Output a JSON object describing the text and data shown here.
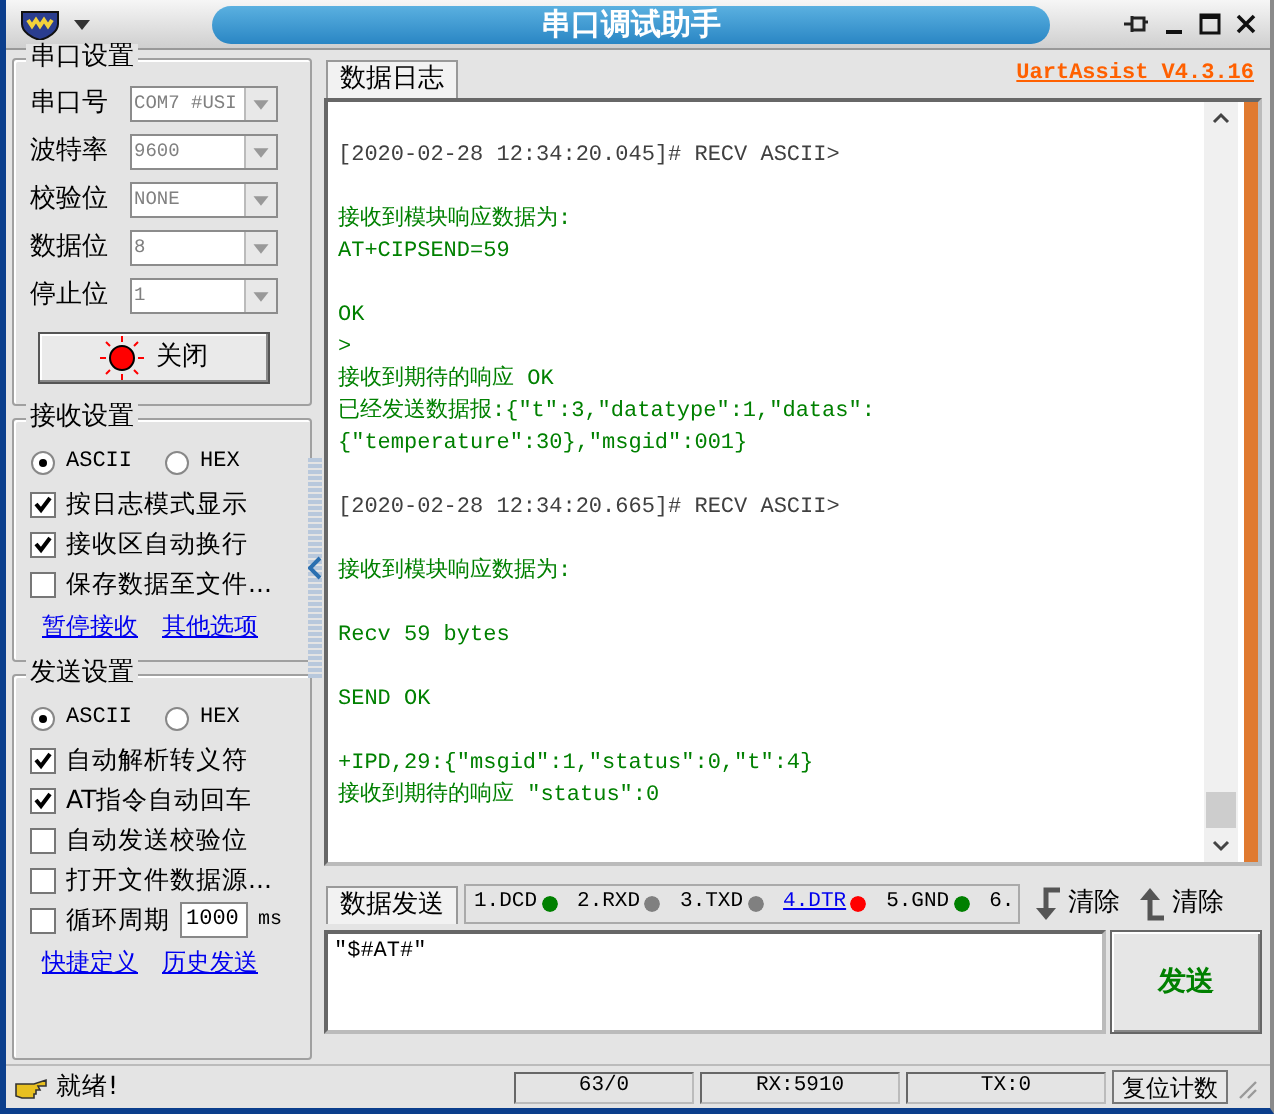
{
  "window": {
    "title": "串口调试助手"
  },
  "version_link": "UartAssist V4.3.16",
  "serial_settings": {
    "title": "串口设置",
    "fields": [
      {
        "label": "串口号",
        "value": "COM7 #USI"
      },
      {
        "label": "波特率",
        "value": "9600"
      },
      {
        "label": "校验位",
        "value": "NONE"
      },
      {
        "label": "数据位",
        "value": "8"
      },
      {
        "label": "停止位",
        "value": "1"
      }
    ],
    "port_button": {
      "label": "关闭",
      "on": true
    }
  },
  "receive_settings": {
    "title": "接收设置",
    "modes": [
      {
        "label": "ASCII",
        "selected": true
      },
      {
        "label": "HEX",
        "selected": false
      }
    ],
    "options": [
      {
        "kind": "check",
        "label": "按日志模式显示",
        "checked": true
      },
      {
        "kind": "check",
        "label": "接收区自动换行",
        "checked": true
      },
      {
        "kind": "check",
        "label": "保存数据至文件...",
        "checked": false
      }
    ],
    "links": [
      "暂停接收",
      "其他选项"
    ]
  },
  "send_settings": {
    "title": "发送设置",
    "modes": [
      {
        "label": "ASCII",
        "selected": true
      },
      {
        "label": "HEX",
        "selected": false
      }
    ],
    "options": [
      {
        "kind": "check",
        "label": "自动解析转义符",
        "checked": true
      },
      {
        "kind": "check",
        "label": "AT指令自动回车",
        "checked": true
      },
      {
        "kind": "check",
        "label": "自动发送校验位",
        "checked": false
      },
      {
        "kind": "check",
        "label": "打开文件数据源...",
        "checked": false
      },
      {
        "kind": "period",
        "label": "循环周期",
        "checked": false,
        "value": "1000",
        "unit": "ms"
      }
    ],
    "links": [
      "快捷定义",
      "历史发送"
    ]
  },
  "log": {
    "tab": "数据日志",
    "blocks": [
      {
        "lines": [
          {
            "kind": "header",
            "text": "[2020-02-28 12:34:20.045]# RECV ASCII>"
          }
        ]
      },
      {
        "lines": [
          {
            "kind": "data",
            "text": "接收到模块响应数据为:"
          },
          {
            "kind": "data",
            "text": "AT+CIPSEND=59"
          }
        ]
      },
      {
        "lines": [
          {
            "kind": "data",
            "text": "OK"
          },
          {
            "kind": "data",
            "text": ">"
          },
          {
            "kind": "data",
            "text": "接收到期待的响应 OK"
          },
          {
            "kind": "data",
            "text": "已经发送数据报:{\"t\":3,\"datatype\":1,\"datas\":"
          },
          {
            "kind": "data",
            "text": "{\"temperature\":30},\"msgid\":001}"
          }
        ]
      },
      {
        "lines": [
          {
            "kind": "header",
            "text": "[2020-02-28 12:34:20.665]# RECV ASCII>"
          }
        ]
      },
      {
        "lines": [
          {
            "kind": "data",
            "text": "接收到模块响应数据为:"
          }
        ]
      },
      {
        "lines": [
          {
            "kind": "data",
            "text": "Recv 59 bytes"
          }
        ]
      },
      {
        "lines": [
          {
            "kind": "data",
            "text": "SEND OK"
          }
        ]
      },
      {
        "lines": [
          {
            "kind": "data",
            "text": "+IPD,29:{\"msgid\":1,\"status\":0,\"t\":4}"
          },
          {
            "kind": "data",
            "text": "接收到期待的响应 \"status\":0"
          }
        ]
      }
    ]
  },
  "send": {
    "tab": "数据发送",
    "pins": [
      {
        "label": "1.DCD",
        "kind": "plain",
        "color": "#008000"
      },
      {
        "label": "2.RXD",
        "kind": "plain",
        "color": "#808080"
      },
      {
        "label": "3.TXD",
        "kind": "plain",
        "color": "#808080"
      },
      {
        "label": "4.DTR",
        "kind": "link",
        "color": "#ff0000"
      },
      {
        "label": "5.GND",
        "kind": "plain",
        "color": "#008000"
      },
      {
        "label": "6.",
        "kind": "plain"
      }
    ],
    "clear_buttons": [
      {
        "kind": "receive",
        "label": "清除"
      },
      {
        "kind": "send",
        "label": "清除"
      }
    ],
    "input_value": "\"$#AT#\"",
    "send_button": "发送"
  },
  "status_bar": {
    "message": "就绪!",
    "counts": [
      "63/0",
      "RX:5910",
      "TX:0"
    ],
    "reset_button": "复位计数"
  }
}
